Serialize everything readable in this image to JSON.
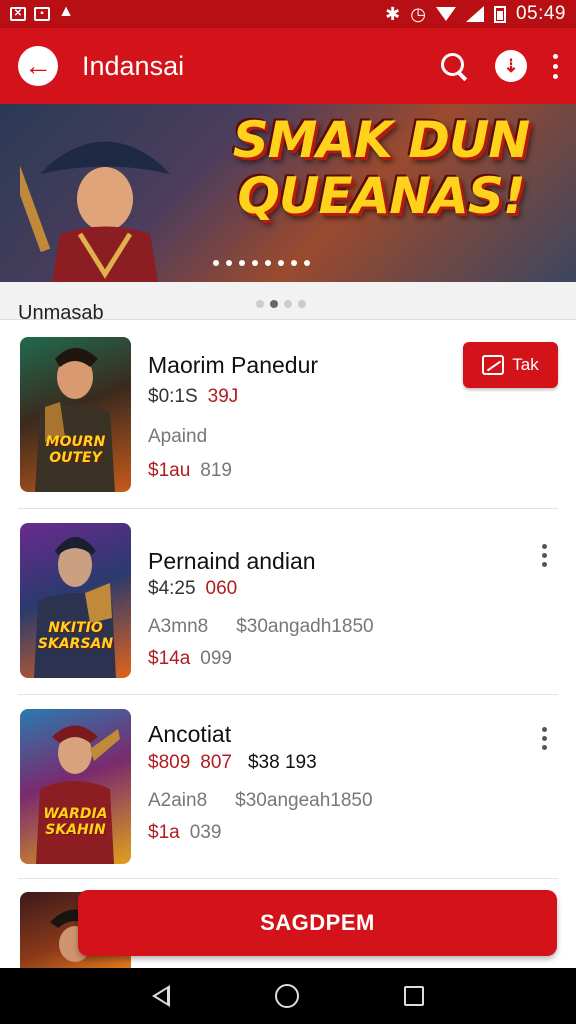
{
  "status_bar": {
    "time": "05:49"
  },
  "app_bar": {
    "title": "Indansai"
  },
  "banner": {
    "title_line1": "SMAK DUN",
    "title_line2": "QUEANAS!",
    "dots": 8
  },
  "section": {
    "label": "Unmasab"
  },
  "items": [
    {
      "title": "Maorim Panedur",
      "price": "$0:1S",
      "price_red": "39J",
      "sub": "Apaind",
      "sub2": "",
      "bottom_red": "$1au",
      "bottom": "819",
      "thumb_text": "MOURN OUTEY",
      "action_label": "Tak"
    },
    {
      "title": "Pernaind andian",
      "price": "$4:25",
      "price_red": "060",
      "sub": "A3mn8",
      "sub2": "$30angadh1850",
      "bottom_red": "$14a",
      "bottom": "099",
      "thumb_text": "NKITIO SKARSAN"
    },
    {
      "title": "Ancotiat",
      "price": "$809",
      "price_red": "807",
      "price_extra": "$38 193",
      "sub": "A2ain8",
      "sub2": "$30angeah1850",
      "bottom_red": "$1a",
      "bottom": "039",
      "thumb_text": "WARDIA SKAHIN"
    }
  ],
  "cta": {
    "label": "SAGDPEM"
  },
  "colors": {
    "primary": "#d41219",
    "status": "#b80f14",
    "accent_text": "#b01c20"
  }
}
